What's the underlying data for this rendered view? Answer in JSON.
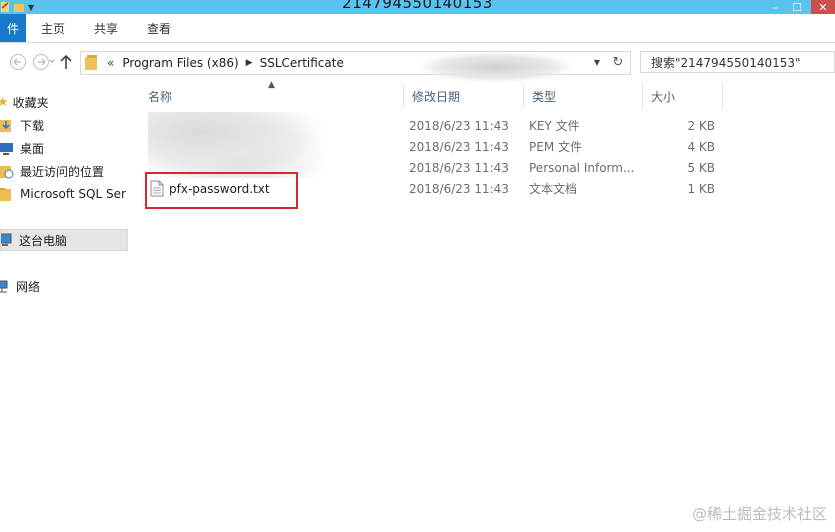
{
  "window": {
    "title": "214794550140153"
  },
  "ribbon": {
    "file_tab": "件",
    "tabs": [
      "主页",
      "共享",
      "查看"
    ]
  },
  "address_bar": {
    "overflow": "«",
    "crumbs": [
      "Program Files (x86)",
      "SSLCertificate"
    ]
  },
  "search": {
    "placeholder": "搜索\"214794550140153\""
  },
  "sidebar": {
    "items": [
      {
        "label": "收藏夹",
        "icon": "star-icon"
      },
      {
        "label": "下载",
        "icon": "download-folder-icon"
      },
      {
        "label": "桌面",
        "icon": "desktop-icon"
      },
      {
        "label": "最近访问的位置",
        "icon": "recent-places-icon"
      },
      {
        "label": "Microsoft SQL Ser",
        "icon": "folder-icon"
      },
      {
        "label": "这台电脑",
        "icon": "computer-icon",
        "selected": true
      },
      {
        "label": "网络",
        "icon": "network-icon"
      }
    ]
  },
  "columns": {
    "name": "名称",
    "modified": "修改日期",
    "type": "类型",
    "size": "大小"
  },
  "files": [
    {
      "name": "",
      "modified": "2018/6/23 11:43",
      "type": "KEY 文件",
      "size": "2 KB"
    },
    {
      "name": "",
      "modified": "2018/6/23 11:43",
      "type": "PEM 文件",
      "size": "4 KB"
    },
    {
      "name": "",
      "modified": "2018/6/23 11:43",
      "type": "Personal Inform...",
      "size": "5 KB"
    },
    {
      "name": "pfx-password.txt",
      "modified": "2018/6/23 11:43",
      "type": "文本文档",
      "size": "1 KB"
    }
  ],
  "watermark": "@稀土掘金技术社区",
  "colors": {
    "titlebar": "#5ac2ee",
    "file_tab": "#1979ca",
    "highlight": "#d9262c"
  }
}
